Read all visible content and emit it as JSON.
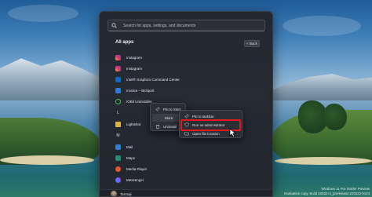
{
  "search": {
    "placeholder": "Search for apps, settings, and documents"
  },
  "all_apps": {
    "title": "All apps",
    "back_label": "< Back"
  },
  "apps": [
    {
      "label": "Instagram",
      "icon": "instagram-icon"
    },
    {
      "label": "Instagram",
      "icon": "instagram-icon"
    },
    {
      "label": "Intel® Graphics Command Center",
      "icon": "intel-graphics-icon"
    },
    {
      "label": "Invoice – Bickpart",
      "icon": "invoice-icon"
    },
    {
      "label": "IOBit Uninstaller",
      "icon": "iobit-icon"
    },
    {
      "label": "L",
      "icon": "letter-tile"
    },
    {
      "label": "Lightshot",
      "icon": "folder-icon"
    },
    {
      "label": "M",
      "icon": "letter-tile"
    },
    {
      "label": "Mail",
      "icon": "mail-icon"
    },
    {
      "label": "Maps",
      "icon": "maps-icon"
    },
    {
      "label": "Media Player",
      "icon": "media-player-icon"
    },
    {
      "label": "Messenger",
      "icon": "messenger-icon"
    }
  ],
  "context_menu": {
    "items": [
      "Pin to Start",
      "More",
      "Uninstall"
    ]
  },
  "sub_menu": {
    "items": [
      "Pin to taskbar",
      "Run as administrator",
      "Open file location"
    ]
  },
  "user": {
    "name": "Tarmoji"
  },
  "watermark": {
    "line1": "Windows 11 Pro Insider Preview",
    "line2": "Evaluation copy. Build 22632.ni_prerelease.220222-0144"
  },
  "colors": {
    "highlight": "#e3191f",
    "menu_background": "#2b2e34",
    "start_background": "#23262c"
  }
}
